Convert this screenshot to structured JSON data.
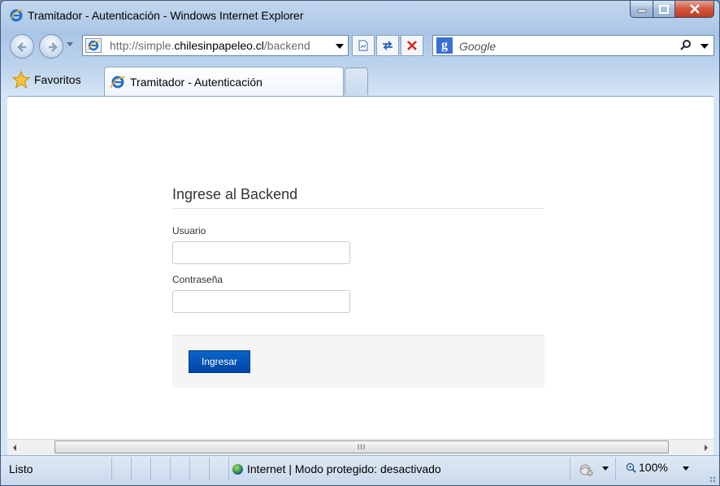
{
  "window": {
    "title": "Tramitador - Autenticación - Windows Internet Explorer"
  },
  "navigation": {
    "address_prefix": "http://simple.",
    "address_domain": "chilesinpapeleo.cl",
    "address_suffix": "/backend",
    "search_placeholder": "Google"
  },
  "favorites": {
    "label": "Favoritos"
  },
  "tab": {
    "title": "Tramitador - Autenticación"
  },
  "form": {
    "heading": "Ingrese al Backend",
    "username_label": "Usuario",
    "username_value": "",
    "password_label": "Contraseña",
    "password_value": "",
    "submit_label": "Ingresar"
  },
  "status": {
    "text": "Listo",
    "zone": "Internet | Modo protegido: desactivado",
    "zoom": "100%"
  },
  "colors": {
    "button": "#0a5ac4",
    "chrome": "#bcd3ec"
  }
}
